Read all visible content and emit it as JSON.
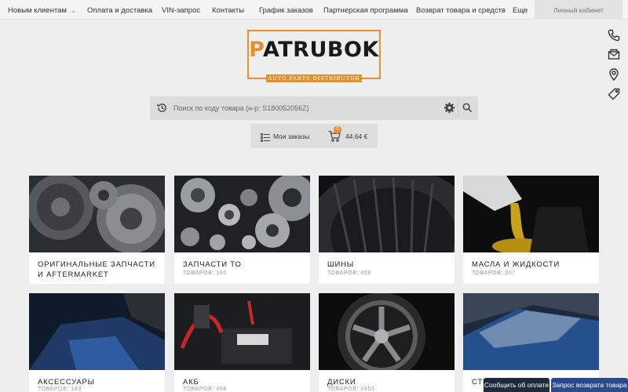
{
  "nav": {
    "items": [
      {
        "label": "Новым клиентам"
      },
      {
        "label": "Оплата и доставка"
      },
      {
        "label": "VIN-запрос"
      },
      {
        "label": "Контакты"
      },
      {
        "label": "График заказов"
      },
      {
        "label": "Партнерская программа"
      },
      {
        "label": "Возврат товара и средств"
      },
      {
        "label": "Еще"
      }
    ],
    "cabinet": "Личный кабинет"
  },
  "side_icons": [
    "phone-icon",
    "mail-icon",
    "location-icon",
    "tag-icon"
  ],
  "logo": {
    "mark": "P",
    "text": "ATRUBOK",
    "tagline": "AUTO PARTS DISTRIBUTOR",
    "accent": "#e8902e"
  },
  "search": {
    "placeholder": "Поиск по коду товара (н-р: S180052056Z)"
  },
  "orders": {
    "label": "Мои заказы",
    "cart_count": "0",
    "total": "44.64 €"
  },
  "categories": [
    {
      "title": "ОРИГИНАЛЬНЫЕ ЗАПЧАСТИ И AFTERMARKET",
      "count": ""
    },
    {
      "title": "ЗАПЧАСТИ ТО",
      "count": "ТОВАРОВ: 160"
    },
    {
      "title": "ШИНЫ",
      "count": "ТОВАРОВ: 408"
    },
    {
      "title": "МАСЛА И ЖИДКОСТИ",
      "count": "ТОВАРОВ: 207"
    },
    {
      "title": "АКСЕССУАРЫ",
      "count": "ТОВАРОВ: 183"
    },
    {
      "title": "АКБ",
      "count": "ТОВАРОВ: 408"
    },
    {
      "title": "ДИСКИ",
      "count": "ТОВАРОВ: 2453"
    },
    {
      "title": "СТЕ",
      "count": ""
    }
  ],
  "buttons": {
    "payment": "Сообщить об оплате",
    "return": "Запрос возврата товара"
  }
}
